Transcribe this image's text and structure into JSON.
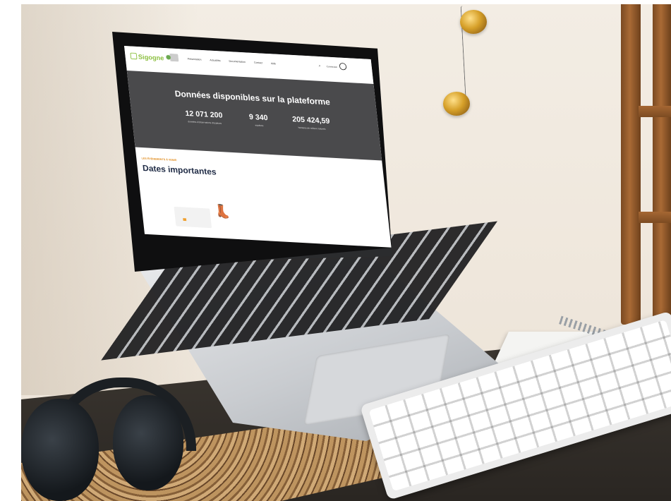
{
  "site": {
    "logo": "Sigogne",
    "nav": [
      "Présentation",
      "Actualités",
      "Documentation",
      "Contact",
      "Aide"
    ],
    "login_label": "Connexion"
  },
  "hero": {
    "title": "Données disponibles sur la plateforme",
    "stats": [
      {
        "value": "12 071 200",
        "label": "données d'observations d'espèces"
      },
      {
        "value": "9 340",
        "label": "espèces"
      },
      {
        "value": "205 424,59",
        "label": "hectares de milieux naturels"
      }
    ]
  },
  "events": {
    "kicker": "LES ÉVÉNEMENTS À VENIR",
    "title": "Dates importantes"
  },
  "icons": {
    "search": "search-icon",
    "account": "user-account-icon",
    "logo": "sigogne-logo-icon"
  },
  "colors": {
    "brand_green": "#8bbf3f",
    "hero_bg": "#4a4a4c",
    "kicker_orange": "#e08a1a",
    "title_navy": "#1e2a44"
  }
}
